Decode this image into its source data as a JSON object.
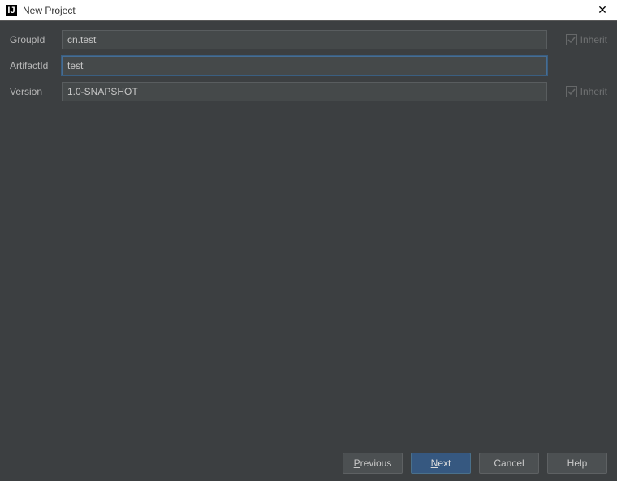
{
  "window": {
    "title": "New Project",
    "icon_text": "IJ"
  },
  "form": {
    "group_id": {
      "label": "GroupId",
      "value": "cn.test",
      "inherit_label": "Inherit",
      "inherit_checked": true
    },
    "artifact_id": {
      "label": "ArtifactId",
      "value": "test"
    },
    "version": {
      "label": "Version",
      "value": "1.0-SNAPSHOT",
      "inherit_label": "Inherit",
      "inherit_checked": true
    }
  },
  "buttons": {
    "previous": "Previous",
    "next": "Next",
    "cancel": "Cancel",
    "help": "Help"
  }
}
